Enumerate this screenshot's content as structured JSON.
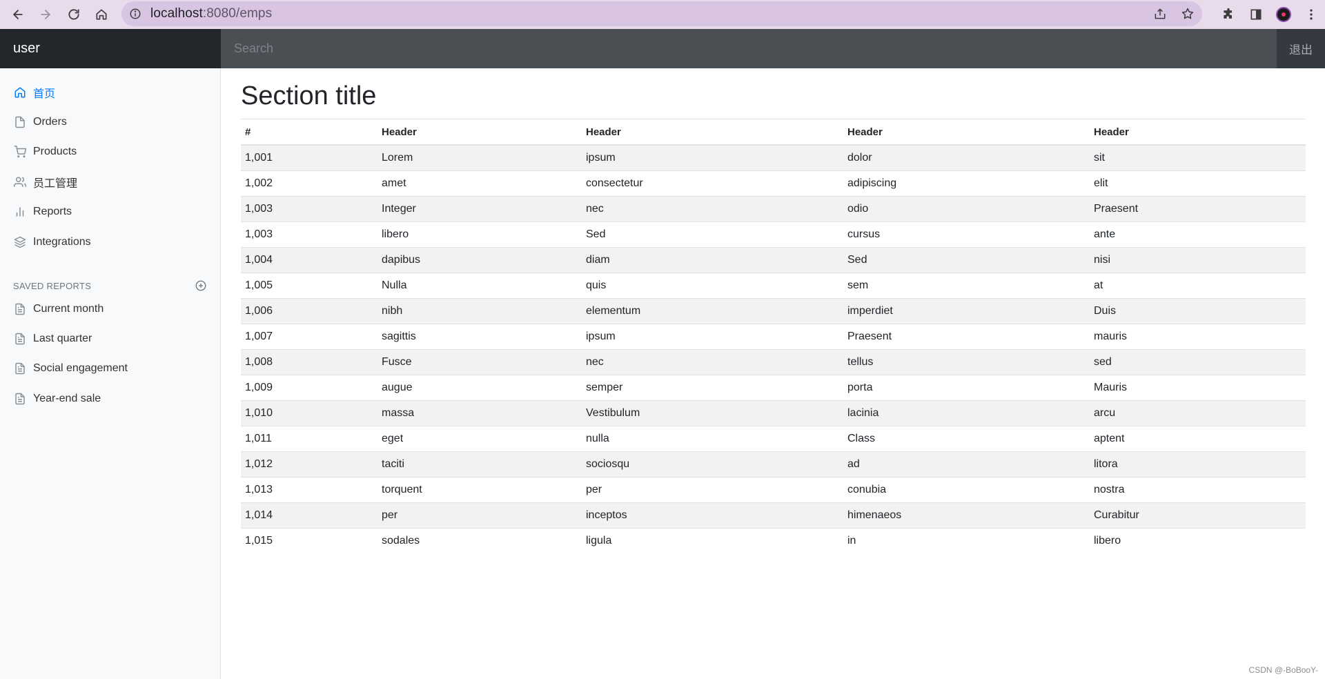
{
  "browser": {
    "url_host": "localhost",
    "url_path": ":8080/emps"
  },
  "navbar": {
    "brand": "user",
    "search_placeholder": "Search",
    "signout_label": "退出"
  },
  "sidebar": {
    "items": [
      {
        "label": "首页",
        "icon": "home-icon",
        "active": true
      },
      {
        "label": "Orders",
        "icon": "file-icon"
      },
      {
        "label": "Products",
        "icon": "shopping-cart-icon"
      },
      {
        "label": "员工管理",
        "icon": "users-icon"
      },
      {
        "label": "Reports",
        "icon": "bar-chart-icon"
      },
      {
        "label": "Integrations",
        "icon": "layers-icon"
      }
    ],
    "saved_reports_heading": "SAVED REPORTS",
    "saved_reports": [
      {
        "label": "Current month",
        "icon": "file-text-icon"
      },
      {
        "label": "Last quarter",
        "icon": "file-text-icon"
      },
      {
        "label": "Social engagement",
        "icon": "file-text-icon"
      },
      {
        "label": "Year-end sale",
        "icon": "file-text-icon"
      }
    ]
  },
  "main": {
    "title": "Section title",
    "table": {
      "headers": [
        "#",
        "Header",
        "Header",
        "Header",
        "Header"
      ],
      "rows": [
        [
          "1,001",
          "Lorem",
          "ipsum",
          "dolor",
          "sit"
        ],
        [
          "1,002",
          "amet",
          "consectetur",
          "adipiscing",
          "elit"
        ],
        [
          "1,003",
          "Integer",
          "nec",
          "odio",
          "Praesent"
        ],
        [
          "1,003",
          "libero",
          "Sed",
          "cursus",
          "ante"
        ],
        [
          "1,004",
          "dapibus",
          "diam",
          "Sed",
          "nisi"
        ],
        [
          "1,005",
          "Nulla",
          "quis",
          "sem",
          "at"
        ],
        [
          "1,006",
          "nibh",
          "elementum",
          "imperdiet",
          "Duis"
        ],
        [
          "1,007",
          "sagittis",
          "ipsum",
          "Praesent",
          "mauris"
        ],
        [
          "1,008",
          "Fusce",
          "nec",
          "tellus",
          "sed"
        ],
        [
          "1,009",
          "augue",
          "semper",
          "porta",
          "Mauris"
        ],
        [
          "1,010",
          "massa",
          "Vestibulum",
          "lacinia",
          "arcu"
        ],
        [
          "1,011",
          "eget",
          "nulla",
          "Class",
          "aptent"
        ],
        [
          "1,012",
          "taciti",
          "sociosqu",
          "ad",
          "litora"
        ],
        [
          "1,013",
          "torquent",
          "per",
          "conubia",
          "nostra"
        ],
        [
          "1,014",
          "per",
          "inceptos",
          "himenaeos",
          "Curabitur"
        ],
        [
          "1,015",
          "sodales",
          "ligula",
          "in",
          "libero"
        ]
      ]
    }
  },
  "watermark": "CSDN @-BoBooY-",
  "colors": {
    "navbar_bg": "#343a40",
    "brand_bg": "#23272b",
    "active_link": "#007bff",
    "browser_bar": "#e8dcec"
  }
}
